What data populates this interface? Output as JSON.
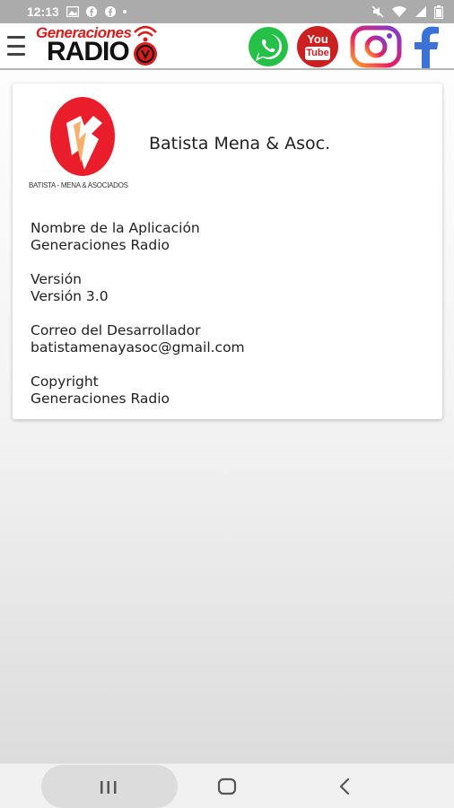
{
  "status_bar": {
    "time": "12:13"
  },
  "header": {
    "brand_top": "Generaciones",
    "brand_bottom": "RADIO",
    "youtube_line1": "You",
    "youtube_line2": "Tube",
    "colors": {
      "brand_red": "#d91c1c",
      "youtube_red": "#cc1f1f",
      "whatsapp_green": "#25c047",
      "facebook_blue": "#3b72d8"
    }
  },
  "card": {
    "logo_caption": "BATISTA - MENA & ASOCIADOS",
    "company_name": "Batista Mena & Asoc.",
    "info": [
      {
        "label": "Nombre de la Aplicación",
        "value": "Generaciones Radio"
      },
      {
        "label": "Versión",
        "value": "Versión 3.0"
      },
      {
        "label": "Correo del Desarrollador",
        "value": "batistamenayasoc@gmail.com"
      },
      {
        "label": "Copyright",
        "value": "Generaciones Radio"
      }
    ]
  }
}
